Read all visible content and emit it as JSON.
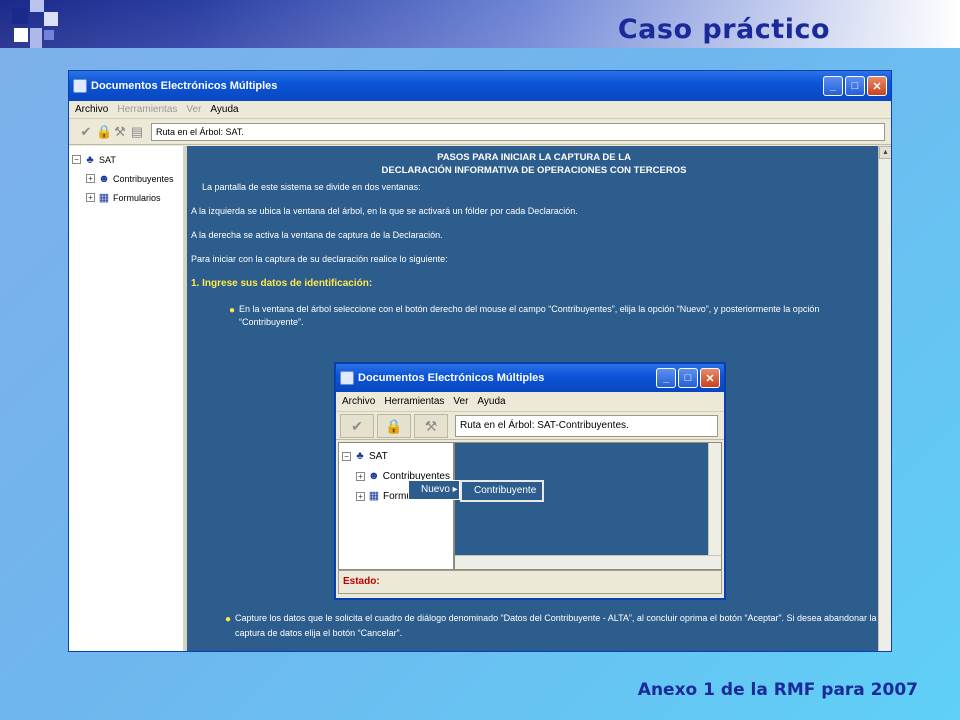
{
  "slide": {
    "title": "Caso práctico",
    "footer": "Anexo 1 de la RMF para 2007"
  },
  "window": {
    "title": "Documentos Electrónicos Múltiples",
    "menu": [
      "Archivo",
      "Herramientas",
      "Ver",
      "Ayuda"
    ],
    "path": "Ruta en el Árbol: SAT.",
    "tree": {
      "root": "SAT",
      "children": [
        "Contribuyentes",
        "Formularios"
      ]
    },
    "content": {
      "heading_line1": "PASOS PARA INICIAR LA CAPTURA DE LA",
      "heading_line2": "DECLARACIÓN INFORMATIVA DE OPERACIONES CON TERCEROS",
      "p1": "La pantalla de este sistema se divide en dos ventanas:",
      "p2": "A la izquierda se ubica la ventana del árbol, en la que se activará un fólder por cada Declaración.",
      "p3": "A la derecha se activa la ventana de captura de la Declaración.",
      "p4": "Para iniciar con la captura de su declaración realice lo siguiente:",
      "section1": "1. Ingrese sus datos de identificación:",
      "bullet1": "En la ventana del árbol seleccione con el botón derecho del mouse el campo “Contribuyentes”, elija la opción “Nuevo”, y posteriormente la opción “Contribuyente”.",
      "bullet2": "Capture los datos que le solicita el cuadro de diálogo denominado “Datos del Contribuyente - ALTA”, al concluir oprima el botón “Aceptar”. Si desea abandonar la captura de datos elija el botón “Cancelar”."
    }
  },
  "inner_window": {
    "title": "Documentos Electrónicos Múltiples",
    "menu": [
      "Archivo",
      "Herramientas",
      "Ver",
      "Ayuda"
    ],
    "path": "Ruta en el Árbol: SAT-Contribuyentes.",
    "tree": {
      "root": "SAT",
      "children": [
        "Contribuyentes",
        "Formu"
      ]
    },
    "context_menu": "Nuevo",
    "submenu": "Contribuyente",
    "status_label": "Estado:"
  },
  "colors": {
    "content_bg": "#2d5d8d",
    "title_blue": "#1a2a9a",
    "section_yellow": "#ffe84a",
    "status_red": "#c00000"
  }
}
